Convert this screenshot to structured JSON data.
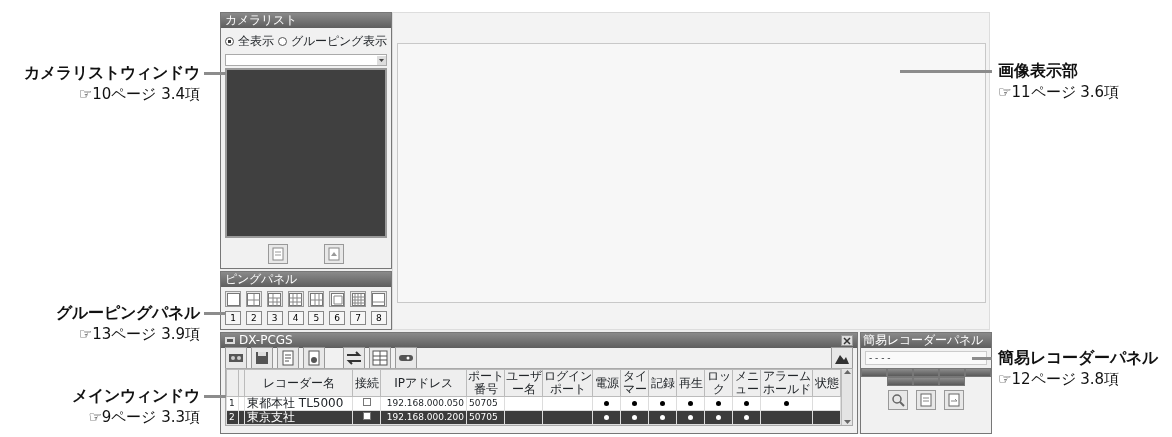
{
  "callouts": [
    {
      "title": "カメラリストウィンドウ",
      "ref": "☞10ページ 3.4項"
    },
    {
      "title": "画像表示部",
      "ref": "☞11ページ 3.6項"
    },
    {
      "title": "グルーピングパネル",
      "ref": "☞13ページ 3.9項"
    },
    {
      "title": "メインウィンドウ",
      "ref": "☞9ページ 3.3項"
    },
    {
      "title": "簡易レコーダーパネル",
      "ref": "☞12ページ 3.8項"
    }
  ],
  "camera_list": {
    "title": "カメラリスト",
    "radios": [
      {
        "label": "全表示",
        "selected": true
      },
      {
        "label": "グルーピング表示",
        "selected": false
      }
    ]
  },
  "grouping_panel": {
    "title": "ピングパネル",
    "numbers": [
      "1",
      "2",
      "3",
      "4",
      "5",
      "6",
      "7",
      "8"
    ]
  },
  "main_window": {
    "title": "DX-PCGS",
    "columns": [
      "レコーダー名",
      "接続",
      "IPアドレス",
      "ポート番号",
      "ユーザー名",
      "ログインポート",
      "電源",
      "タイマー",
      "記録",
      "再生",
      "ロック",
      "メニュー",
      "アラームホールド",
      "状態"
    ],
    "rows": [
      {
        "no": "1",
        "name": "東都本社 TL5000",
        "connected": false,
        "ip": "192.168.000.050",
        "port": "50705",
        "flags": [
          true,
          true,
          true,
          true,
          true,
          true,
          true
        ],
        "selected": false
      },
      {
        "no": "2",
        "name": "東京支社",
        "connected": false,
        "ip": "192.168.000.200",
        "port": "50705",
        "flags": [
          true,
          true,
          true,
          true,
          true,
          true,
          false
        ],
        "selected": true
      }
    ]
  },
  "recorder_panel": {
    "title": "簡易レコーダーパネル",
    "field": "- - - -"
  }
}
